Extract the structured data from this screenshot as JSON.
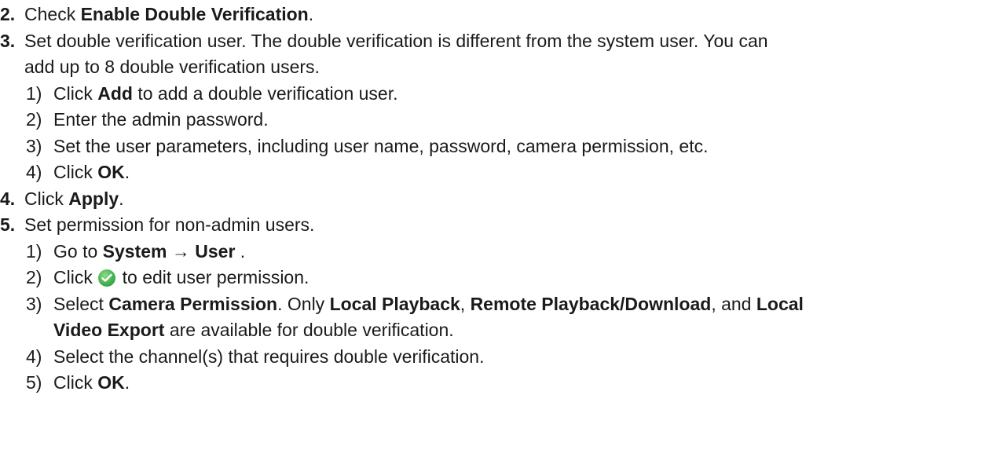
{
  "steps": [
    {
      "num": "2.",
      "text_before": "Check ",
      "bold": "Enable Double Verification",
      "text_after": "."
    },
    {
      "num": "3.",
      "line1": "Set double verification user. The double verification is different from the system user. You can",
      "line2": "add up to 8 double verification users.",
      "substeps": [
        {
          "num": "1)",
          "before": "Click ",
          "bold": "Add",
          "after": " to add a double verification user."
        },
        {
          "num": "2)",
          "text": "Enter the admin password."
        },
        {
          "num": "3)",
          "text": "Set the user parameters, including user name, password, camera permission, etc."
        },
        {
          "num": "4)",
          "before": "Click ",
          "bold": "OK",
          "after": "."
        }
      ]
    },
    {
      "num": "4.",
      "text_before": "Click ",
      "bold": "Apply",
      "text_after": "."
    },
    {
      "num": "5.",
      "text": "Set permission for non-admin users.",
      "substeps": [
        {
          "num": "1)",
          "before": "Go to ",
          "bold": "System → User",
          "after": " ."
        },
        {
          "num": "2)",
          "before": "Click ",
          "icon": "check-circle-icon",
          "after": " to edit user permission."
        },
        {
          "num": "3)",
          "before": "Select ",
          "bold1": "Camera Permission",
          "mid1": ". Only ",
          "bold2": "Local Playback",
          "mid2": ", ",
          "bold3": "Remote Playback/Download",
          "mid3": ", and ",
          "bold4": "Local",
          "line2_bold": "Video Export",
          "line2_after": " are available for double verification."
        },
        {
          "num": "4)",
          "text": "Select the channel(s) that requires double verification."
        },
        {
          "num": "5)",
          "before": "Click ",
          "bold": "OK",
          "after": "."
        }
      ]
    }
  ],
  "colors": {
    "text": "#1a1a1a",
    "icon_green": "#3fae4b"
  }
}
